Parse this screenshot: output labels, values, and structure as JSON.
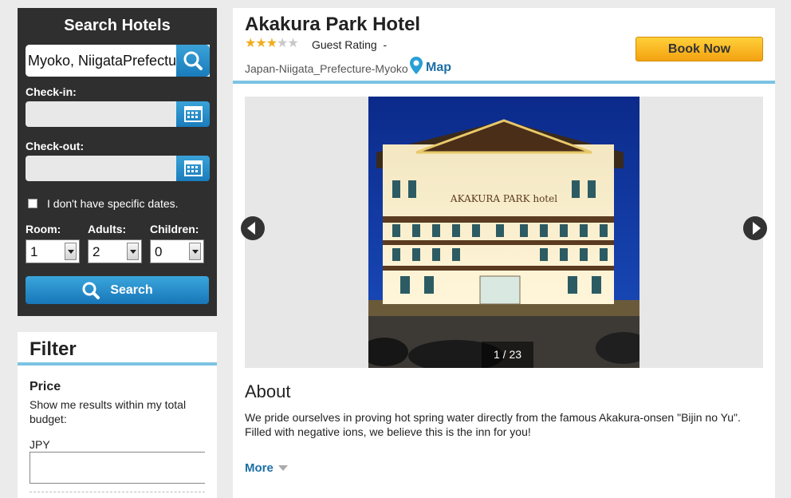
{
  "search": {
    "title": "Search Hotels",
    "destination_value": "Myoko, NiigataPrefecture",
    "checkin_label": "Check-in:",
    "checkout_label": "Check-out:",
    "no_dates_label": "I don't have specific dates.",
    "no_dates_checked": false,
    "room_label": "Room:",
    "adults_label": "Adults:",
    "children_label": "Children:",
    "room_value": "1",
    "adults_value": "2",
    "children_value": "0",
    "search_button": "Search"
  },
  "filter": {
    "title": "Filter",
    "price_title": "Price",
    "price_desc": "Show me results within my total budget:",
    "currency": "JPY"
  },
  "hotel": {
    "name": "Akakura Park Hotel",
    "star_rating": 3,
    "star_max": 5,
    "guest_rating_label": "Guest Rating",
    "guest_rating_value": "-",
    "location": "Japan-Niigata_Prefecture-Myoko",
    "map_link": "Map",
    "book_button": "Book Now"
  },
  "gallery": {
    "counter": "1 / 23",
    "photo_sign": "AKAKURA PARK hotel"
  },
  "about": {
    "title": "About",
    "text": "We pride ourselves in proving hot spring water directly from the famous Akakura-onsen \"Bijin no Yu\". Filled with negative ions, we believe this is the inn for you!",
    "more_link": "More"
  },
  "colors": {
    "accent_blue": "#1a7cbc",
    "link_blue": "#1d6fa5",
    "book_orange": "#f4a210",
    "divider_blue": "#7cc3e3",
    "star_gold": "#f0ad1e"
  },
  "icons": [
    "search-icon",
    "calendar-icon",
    "map-pin-icon",
    "chevron-left-icon",
    "chevron-right-icon",
    "chevron-down-icon",
    "star-icon"
  ]
}
